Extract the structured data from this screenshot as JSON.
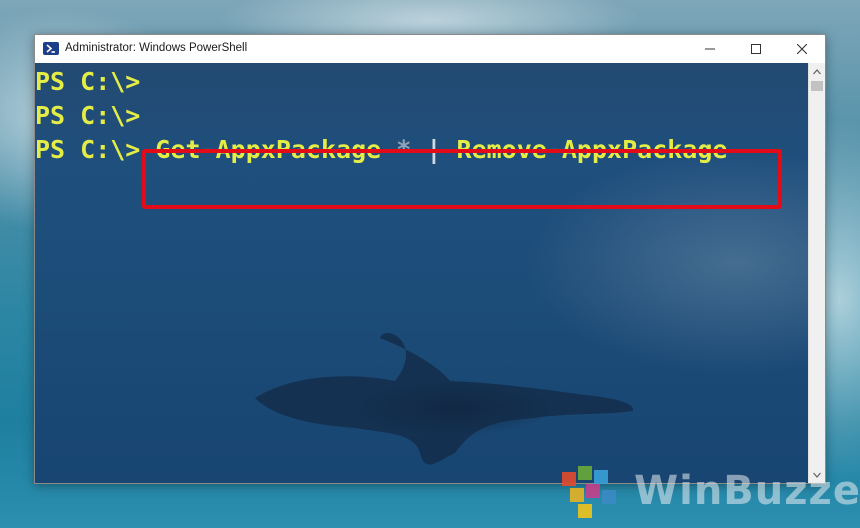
{
  "window": {
    "title": "Administrator: Windows PowerShell",
    "icon": "powershell-icon"
  },
  "console": {
    "lines": [
      {
        "prompt": "PS C:\\>",
        "command": ""
      },
      {
        "prompt": "PS C:\\>",
        "command": ""
      },
      {
        "prompt": "PS C:\\>",
        "command_part1": "Get-AppxPackage",
        "asterisk": "*",
        "pipe": "|",
        "command_part2": "Remove-AppxPackage"
      }
    ],
    "text_color": "#e4ec46",
    "highlight_color": "#e30b17"
  },
  "controls": {
    "minimize_icon": "minimize-icon",
    "maximize_icon": "maximize-icon",
    "close_icon": "close-icon"
  },
  "watermark": {
    "text": "WinBuzzer"
  }
}
